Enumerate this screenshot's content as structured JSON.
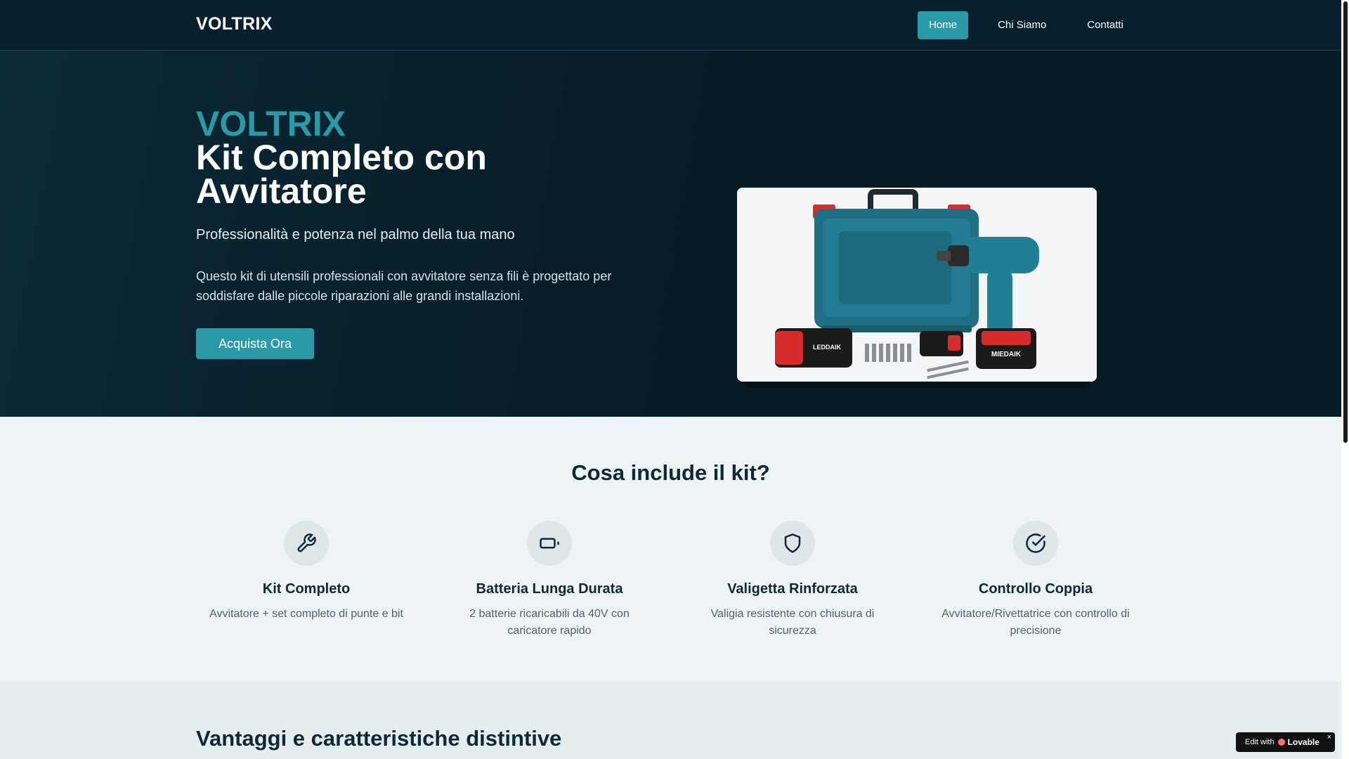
{
  "nav": {
    "brand": "VOLTRIX",
    "links": [
      "Home",
      "Chi Siamo",
      "Contatti"
    ]
  },
  "hero": {
    "brand": "VOLTRIX",
    "title": "Kit Completo con Avvitatore",
    "subtitle": "Professionalità e potenza nel palmo della tua mano",
    "description": "Questo kit di utensili professionali con avvitatore senza fili è progettato per soddisfare dalle piccole riparazioni alle grandi installazioni.",
    "cta": "Acquista Ora",
    "image": {
      "battery_label_1": "LEDDAIK",
      "battery_label_2": "MIEDAIK"
    }
  },
  "features": {
    "title": "Cosa include il kit?",
    "items": [
      {
        "icon": "wrench-icon",
        "title": "Kit Completo",
        "desc": "Avvitatore + set completo di punte e bit"
      },
      {
        "icon": "battery-icon",
        "title": "Batteria Lunga Durata",
        "desc": "2 batterie ricaricabili da 40V con caricatore rapido"
      },
      {
        "icon": "shield-icon",
        "title": "Valigetta Rinforzata",
        "desc": "Valigia resistente con chiusura di sicurezza"
      },
      {
        "icon": "check-circle-icon",
        "title": "Controllo Coppia",
        "desc": "Avvitatore/Rivettatrice con controllo di precisione"
      }
    ]
  },
  "advantages": {
    "title": "Vantaggi e caratteristiche distintive"
  },
  "badge": {
    "prefix": "Edit with",
    "brand": "Lovable",
    "close": "×"
  },
  "colors": {
    "accent": "#2a9aa8",
    "nav_bg": "#08202d",
    "hero_bg": "#061a24",
    "section_bg": "#eef3f6",
    "heading": "#0d2836"
  }
}
